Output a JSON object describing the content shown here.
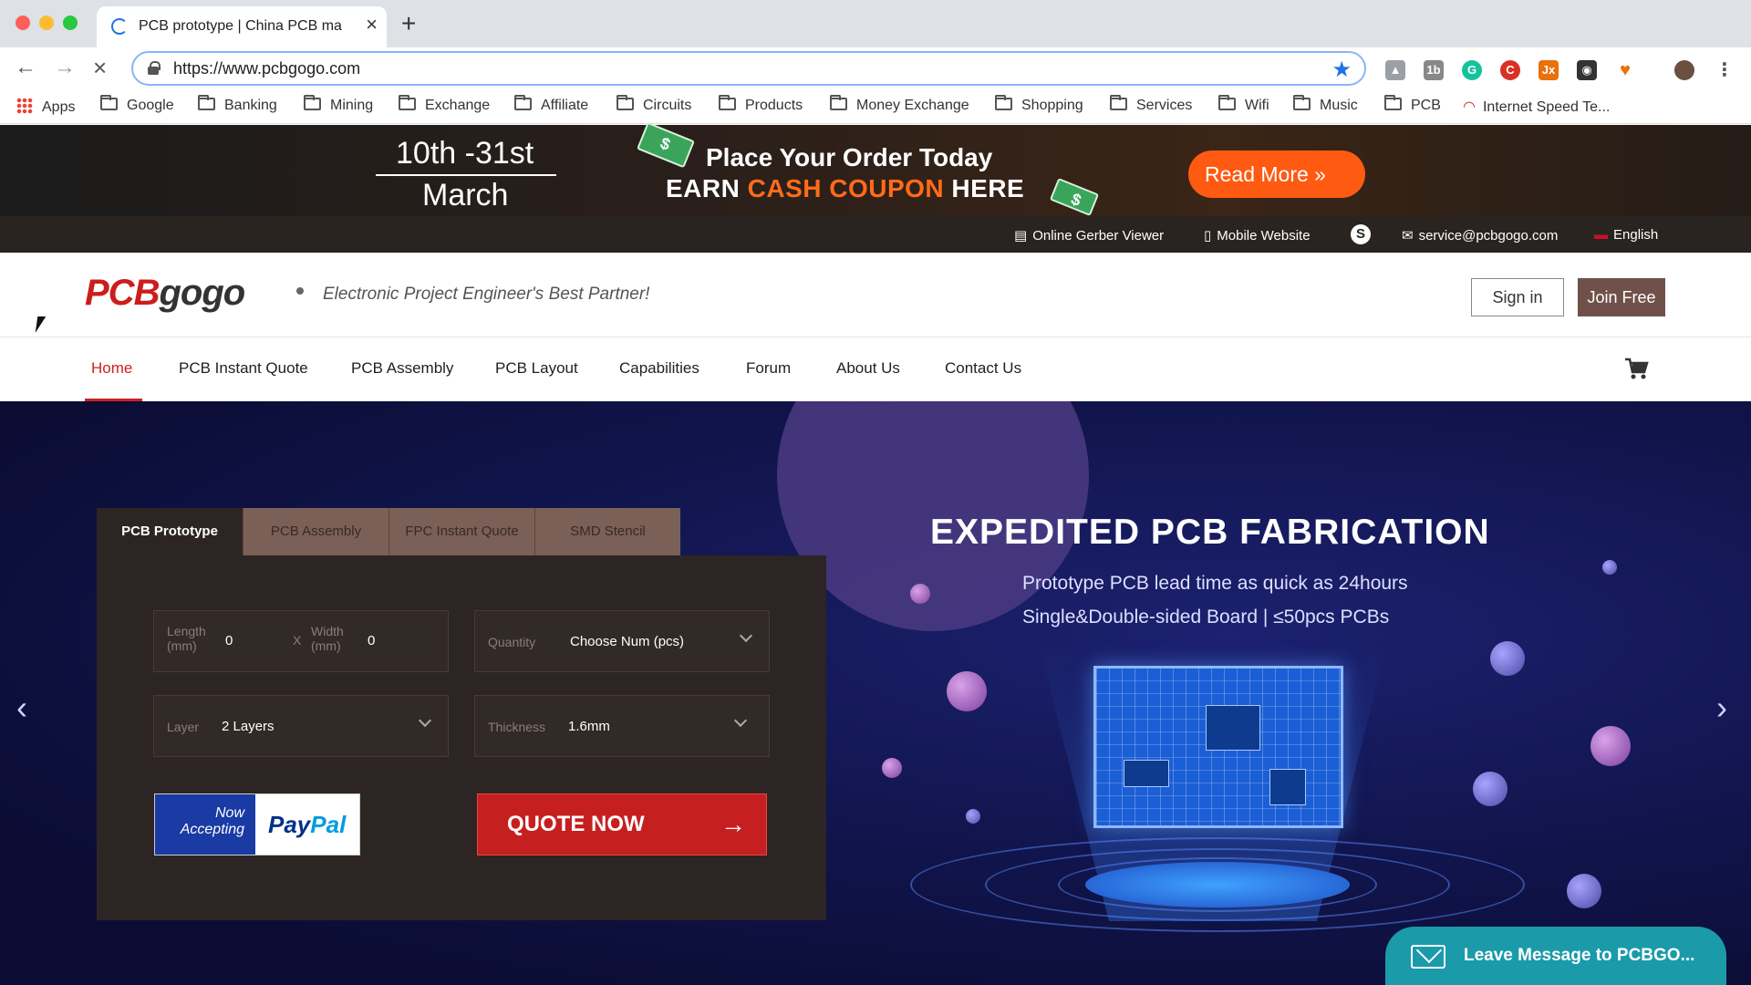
{
  "browser": {
    "tab_title": "PCB prototype | China PCB ma",
    "url": "https://www.pcbgogo.com",
    "bookmarks": [
      {
        "label": "Apps",
        "icon": "apps-grid-icon"
      },
      {
        "label": "Google",
        "icon": "folder-icon"
      },
      {
        "label": "Banking",
        "icon": "folder-icon"
      },
      {
        "label": "Mining",
        "icon": "folder-icon"
      },
      {
        "label": "Exchange",
        "icon": "folder-icon"
      },
      {
        "label": "Affiliate",
        "icon": "folder-icon"
      },
      {
        "label": "Circuits",
        "icon": "folder-icon"
      },
      {
        "label": "Products",
        "icon": "folder-icon"
      },
      {
        "label": "Money Exchange",
        "icon": "folder-icon"
      },
      {
        "label": "Shopping",
        "icon": "folder-icon"
      },
      {
        "label": "Services",
        "icon": "folder-icon"
      },
      {
        "label": "Wifi",
        "icon": "folder-icon"
      },
      {
        "label": "Music",
        "icon": "folder-icon"
      },
      {
        "label": "PCB",
        "icon": "folder-icon"
      },
      {
        "label": "Internet Speed Te...",
        "icon": "speedometer-icon"
      }
    ]
  },
  "promo": {
    "date_line1": "10th -31st",
    "date_line2": "March",
    "headline1": "Place Your Order Today",
    "headline2_a": "EARN ",
    "headline2_b": "CASH COUPON",
    "headline2_c": " HERE",
    "cta": "Read More",
    "accent_color": "#ff5a12"
  },
  "infobar": {
    "gerber": "Online Gerber Viewer",
    "mobile": "Mobile Website",
    "email": "service@pcbgogo.com",
    "language": "English"
  },
  "header": {
    "logo_part1": "PCB",
    "logo_part2": "gogo",
    "tagline": "Electronic Project Engineer's Best Partner!",
    "signin": "Sign in",
    "joinfree": "Join Free"
  },
  "nav": {
    "items": [
      "Home",
      "PCB Instant Quote",
      "PCB Assembly",
      "PCB Layout",
      "Capabilities",
      "Forum",
      "About Us",
      "Contact Us"
    ],
    "active": "Home"
  },
  "hero": {
    "title": "EXPEDITED PCB FABRICATION",
    "sub1": "Prototype PCB lead time as quick as 24hours",
    "sub2": "Single&Double-sided Board | ≤50pcs PCBs"
  },
  "quote": {
    "tabs": [
      "PCB Prototype",
      "PCB Assembly",
      "FPC Instant Quote",
      "SMD Stencil"
    ],
    "active_tab": "PCB Prototype",
    "length_label": "Length (mm)",
    "length_value": "0",
    "x_label": "X",
    "width_label": "Width (mm)",
    "width_value": "0",
    "quantity_label": "Quantity",
    "quantity_value": "Choose Num (pcs)",
    "layer_label": "Layer",
    "layer_value": "2 Layers",
    "thickness_label": "Thickness",
    "thickness_value": "1.6mm",
    "paypal_note1": "Now",
    "paypal_note2": "Accepting",
    "paypal_pay": "Pay",
    "paypal_pal": "Pal",
    "quote_button": "QUOTE NOW"
  },
  "chat": {
    "label": "Leave Message to PCBGO..."
  }
}
